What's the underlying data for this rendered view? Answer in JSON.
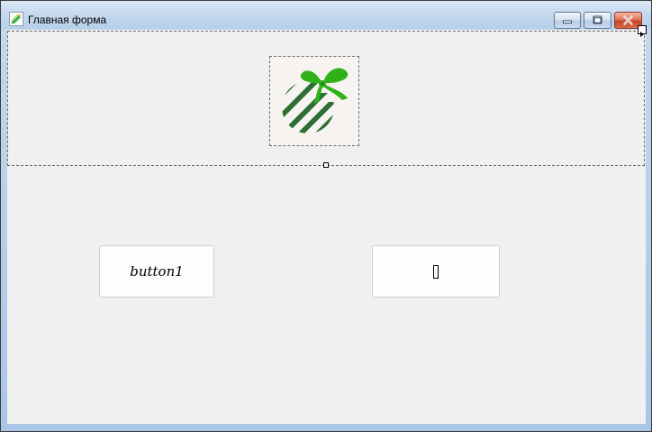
{
  "window": {
    "title": "Главная форма",
    "app_icon": "sparkle-app-icon",
    "controls": {
      "minimize_icon": "minimize-icon",
      "maximize_icon": "maximize-icon",
      "close_icon": "close-icon"
    }
  },
  "panel": {
    "picture": {
      "icon": "christmas-ornament-icon",
      "colors": {
        "ornament": "#2c6e33",
        "bow": "#2fb11a",
        "background": "#f6f3f1"
      }
    }
  },
  "buttons": {
    "button1_label": "button1",
    "button2_glyph": "missing-glyph-icon"
  },
  "colors": {
    "client_background": "#f0f0f0",
    "titlebar": "#c4d8ee",
    "close_button": "#c8442a"
  }
}
